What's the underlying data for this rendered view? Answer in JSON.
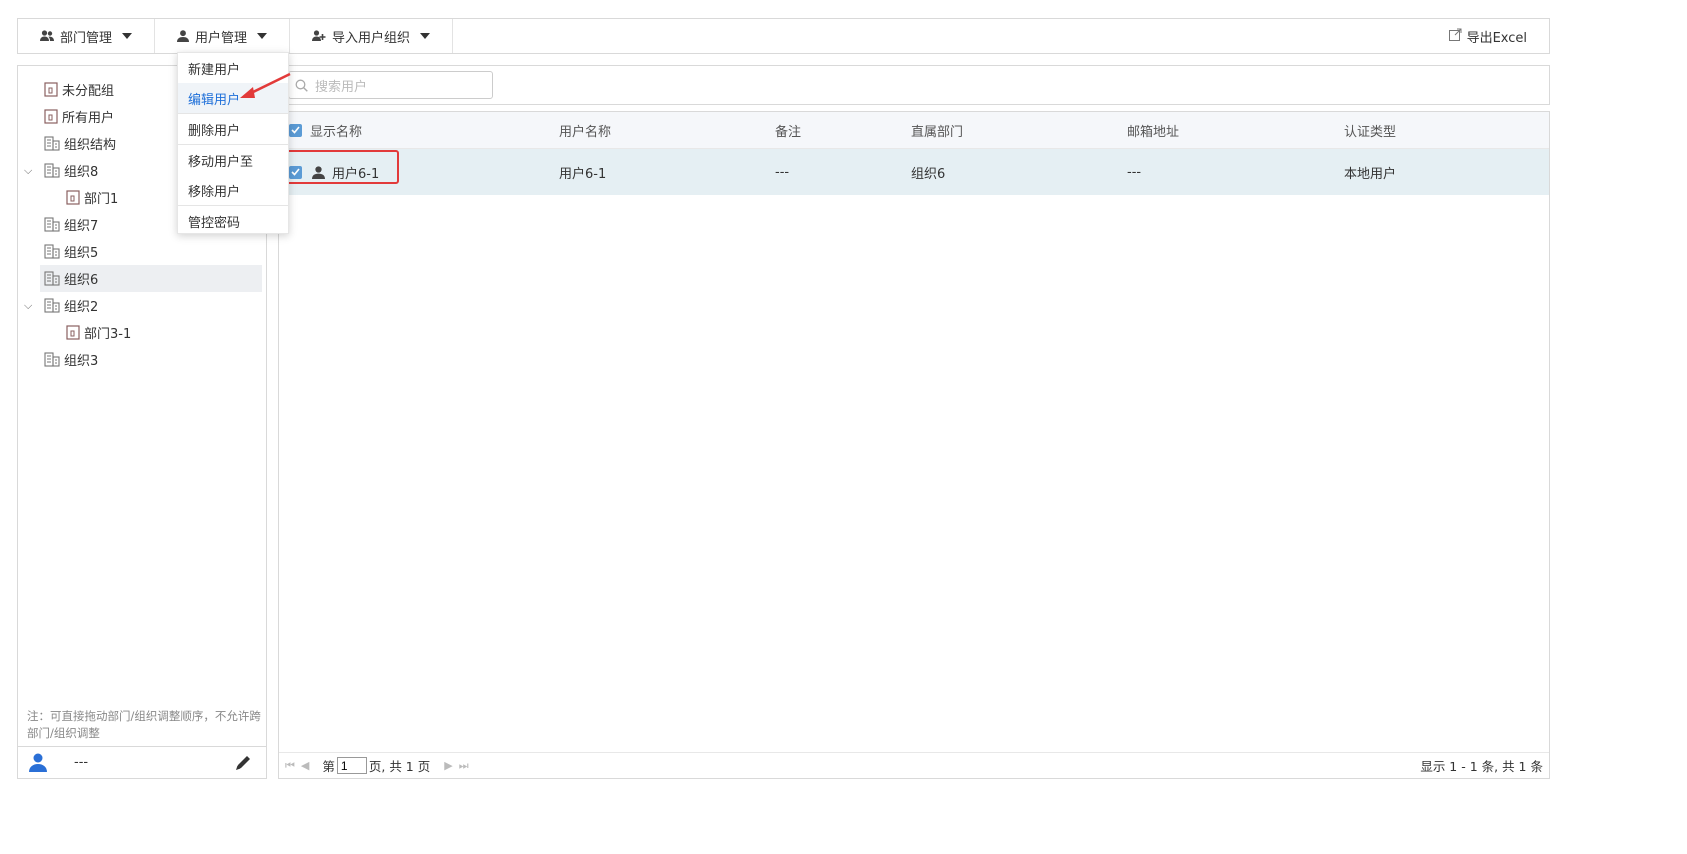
{
  "toolbar": {
    "dept_mgmt": "部门管理",
    "user_mgmt": "用户管理",
    "import_org": "导入用户组织",
    "export": "导出Excel"
  },
  "user_menu": {
    "items": [
      "新建用户",
      "编辑用户",
      "删除用户",
      "移动用户至",
      "移除用户",
      "管控密码"
    ],
    "active_index": 1
  },
  "tree": {
    "nodes": [
      {
        "label": "未分配组",
        "icon": "dept-icon"
      },
      {
        "label": "所有用户",
        "icon": "dept-icon"
      },
      {
        "label": "组织结构",
        "icon": "org-icon"
      },
      {
        "label": "组织8",
        "icon": "org-icon",
        "expanded": true
      },
      {
        "label": "部门1",
        "icon": "dept-icon"
      },
      {
        "label": "组织7",
        "icon": "org-icon"
      },
      {
        "label": "组织5",
        "icon": "org-icon"
      },
      {
        "label": "组织6",
        "icon": "org-icon",
        "selected": true
      },
      {
        "label": "组织2",
        "icon": "org-icon",
        "expanded": true
      },
      {
        "label": "部门3-1",
        "icon": "dept-icon"
      },
      {
        "label": "组织3",
        "icon": "org-icon"
      }
    ],
    "note": "注：可直接拖动部门/组织调整顺序，不允许跨部门/组织调整",
    "footer_value": "---"
  },
  "search": {
    "placeholder": "搜索用户"
  },
  "table": {
    "headers": [
      "显示名称",
      "用户名称",
      "备注",
      "直属部门",
      "邮箱地址",
      "认证类型"
    ],
    "rows": [
      {
        "display_name": "用户6-1",
        "username": "用户6-1",
        "remark": "---",
        "dept": "组织6",
        "email": "---",
        "auth": "本地用户"
      }
    ]
  },
  "pager": {
    "page_prefix": "第",
    "page_value": "1",
    "page_suffix": "页, 共 1 页",
    "summary": "显示 1 - 1 条, 共 1 条"
  },
  "colors": {
    "accent": "#1e6fd9",
    "highlight": "#e23a3a",
    "row_selected": "#e5eff3"
  }
}
